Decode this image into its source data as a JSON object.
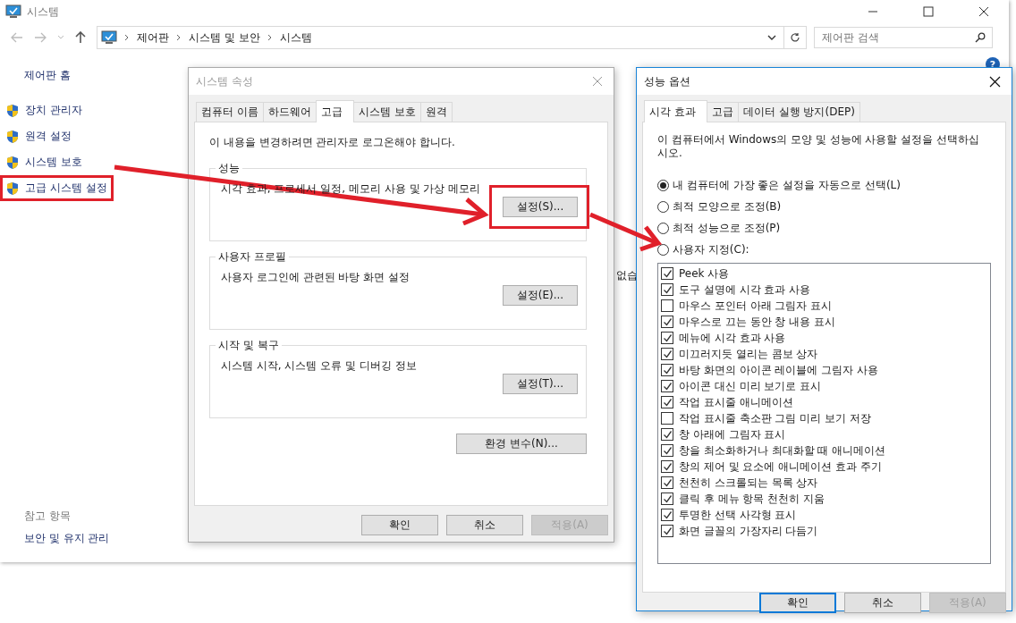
{
  "window": {
    "title": "시스템",
    "breadcrumb": [
      "제어판",
      "시스템 및 보안",
      "시스템"
    ],
    "search": {
      "placeholder": "제어판 검색"
    },
    "help": "?",
    "sidebar": {
      "home": "제어판 홈",
      "links": [
        {
          "label": "장치 관리자",
          "highlighted": false
        },
        {
          "label": "원격 설정",
          "highlighted": false
        },
        {
          "label": "시스템 보호",
          "highlighted": false
        },
        {
          "label": "고급 시스템 설정",
          "highlighted": true
        }
      ],
      "see_also": {
        "title": "참고 항목",
        "links": [
          "보안 및 유지 관리"
        ]
      }
    },
    "partial_text": "없습"
  },
  "system_properties": {
    "title": "시스템 속성",
    "tabs": [
      {
        "label": "컴퓨터 이름",
        "selected": false
      },
      {
        "label": "하드웨어",
        "selected": false
      },
      {
        "label": "고급",
        "selected": true
      },
      {
        "label": "시스템 보호",
        "selected": false
      },
      {
        "label": "원격",
        "selected": false
      }
    ],
    "notice": "이 내용을 변경하려면 관리자로 로그온해야 합니다.",
    "groups": [
      {
        "title": "성능",
        "description": "시각 효과, 프로세서 일정, 메모리 사용 및 가상 메모리",
        "button": {
          "label": "설정(S)...",
          "highlighted": true
        }
      },
      {
        "title": "사용자 프로필",
        "description": "사용자 로그인에 관련된 바탕 화면 설정",
        "button": {
          "label": "설정(E)...",
          "highlighted": false
        }
      },
      {
        "title": "시작 및 복구",
        "description": "시스템 시작, 시스템 오류 및 디버깅 정보",
        "button": {
          "label": "설정(T)...",
          "highlighted": false
        }
      }
    ],
    "env_button": "환경 변수(N)...",
    "buttons": [
      {
        "label": "확인",
        "disabled": false,
        "default": false
      },
      {
        "label": "취소",
        "disabled": false,
        "default": false
      },
      {
        "label": "적용(A)",
        "disabled": true,
        "default": false
      }
    ]
  },
  "performance_options": {
    "title": "성능 옵션",
    "tabs": [
      {
        "label": "시각 효과",
        "selected": true
      },
      {
        "label": "고급",
        "selected": false
      },
      {
        "label": "데이터 실행 방지(DEP)",
        "selected": false
      }
    ],
    "description": "이 컴퓨터에서 Windows의 모양 및 성능에 사용할 설정을 선택하십시오.",
    "radios": [
      {
        "label": "내 컴퓨터에 가장 좋은 설정을 자동으로 선택(L)",
        "selected": true
      },
      {
        "label": "최적 모양으로 조정(B)",
        "selected": false
      },
      {
        "label": "최적 성능으로 조정(P)",
        "selected": false
      },
      {
        "label": "사용자 지정(C):",
        "selected": false
      }
    ],
    "effects": [
      {
        "label": "Peek 사용",
        "checked": true
      },
      {
        "label": "도구 설명에 시각 효과 사용",
        "checked": true
      },
      {
        "label": "마우스 포인터 아래 그림자 표시",
        "checked": false
      },
      {
        "label": "마우스로 끄는 동안 창 내용 표시",
        "checked": true
      },
      {
        "label": "메뉴에 시각 효과 사용",
        "checked": true
      },
      {
        "label": "미끄러지듯 열리는 콤보 상자",
        "checked": true
      },
      {
        "label": "바탕 화면의 아이콘 레이블에 그림자 사용",
        "checked": true
      },
      {
        "label": "아이콘 대신 미리 보기로 표시",
        "checked": true
      },
      {
        "label": "작업 표시줄 애니메이션",
        "checked": true
      },
      {
        "label": "작업 표시줄 축소판 그림 미리 보기 저장",
        "checked": false
      },
      {
        "label": "창 아래에 그림자 표시",
        "checked": true
      },
      {
        "label": "창을 최소화하거나 최대화할 때 애니메이션",
        "checked": true
      },
      {
        "label": "창의 제어 및 요소에 애니메이션 효과 주기",
        "checked": true
      },
      {
        "label": "천천히 스크롤되는 목록 상자",
        "checked": true
      },
      {
        "label": "클릭 후 메뉴 항목 천천히 지움",
        "checked": true
      },
      {
        "label": "투명한 선택 사각형 표시",
        "checked": true
      },
      {
        "label": "화면 글꼴의 가장자리 다듬기",
        "checked": true
      }
    ],
    "buttons": [
      {
        "label": "확인",
        "disabled": false,
        "default": true
      },
      {
        "label": "취소",
        "disabled": false,
        "default": false
      },
      {
        "label": "적용(A)",
        "disabled": true,
        "default": false
      }
    ]
  }
}
